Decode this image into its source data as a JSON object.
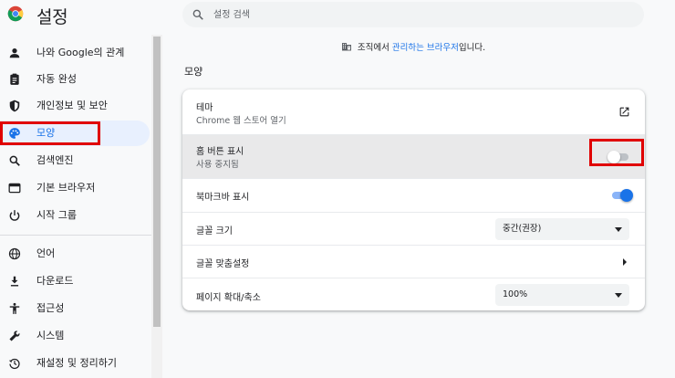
{
  "header": {
    "title": "설정",
    "logo_icon": "chrome-logo",
    "search": {
      "placeholder": "설정 검색",
      "value": ""
    }
  },
  "sidebar": {
    "items": [
      {
        "label": "나와 Google의 관계",
        "icon": "person-icon"
      },
      {
        "label": "자동 완성",
        "icon": "clipboard-icon"
      },
      {
        "label": "개인정보 및 보안",
        "icon": "shield-icon"
      },
      {
        "label": "모양",
        "icon": "palette-icon",
        "active": true
      },
      {
        "label": "검색엔진",
        "icon": "search-icon"
      },
      {
        "label": "기본 브라우저",
        "icon": "browser-icon"
      },
      {
        "label": "시작 그룹",
        "icon": "power-icon"
      },
      {
        "label": "언어",
        "icon": "globe-icon"
      },
      {
        "label": "다운로드",
        "icon": "download-icon"
      },
      {
        "label": "접근성",
        "icon": "accessibility-icon"
      },
      {
        "label": "시스템",
        "icon": "wrench-icon"
      },
      {
        "label": "재설정 및 정리하기",
        "icon": "history-icon"
      }
    ]
  },
  "main": {
    "managed_notice": {
      "prefix": "조직에서 ",
      "link": "관리하는 브라우저",
      "suffix": "입니다.",
      "icon": "building-icon"
    },
    "section_title": "모양",
    "rows": {
      "theme": {
        "label": "테마",
        "sub": "Chrome 웹 스토어 열기",
        "icon": "external-link-icon"
      },
      "home_button": {
        "label": "홈 버튼 표시",
        "sub": "사용 중지됨",
        "toggle_on": false
      },
      "bookmarks_bar": {
        "label": "북마크바 표시",
        "toggle_on": true
      },
      "font_size": {
        "label": "글꼴 크기",
        "value": "중간(권장)"
      },
      "customize_fonts": {
        "label": "글꼴 맞춤설정"
      },
      "page_zoom": {
        "label": "페이지 확대/축소",
        "value": "100%"
      }
    }
  },
  "colors": {
    "accent": "#1a73e8",
    "annotation_box": "#e00000",
    "active_nav_bg": "#e8f0fe"
  }
}
